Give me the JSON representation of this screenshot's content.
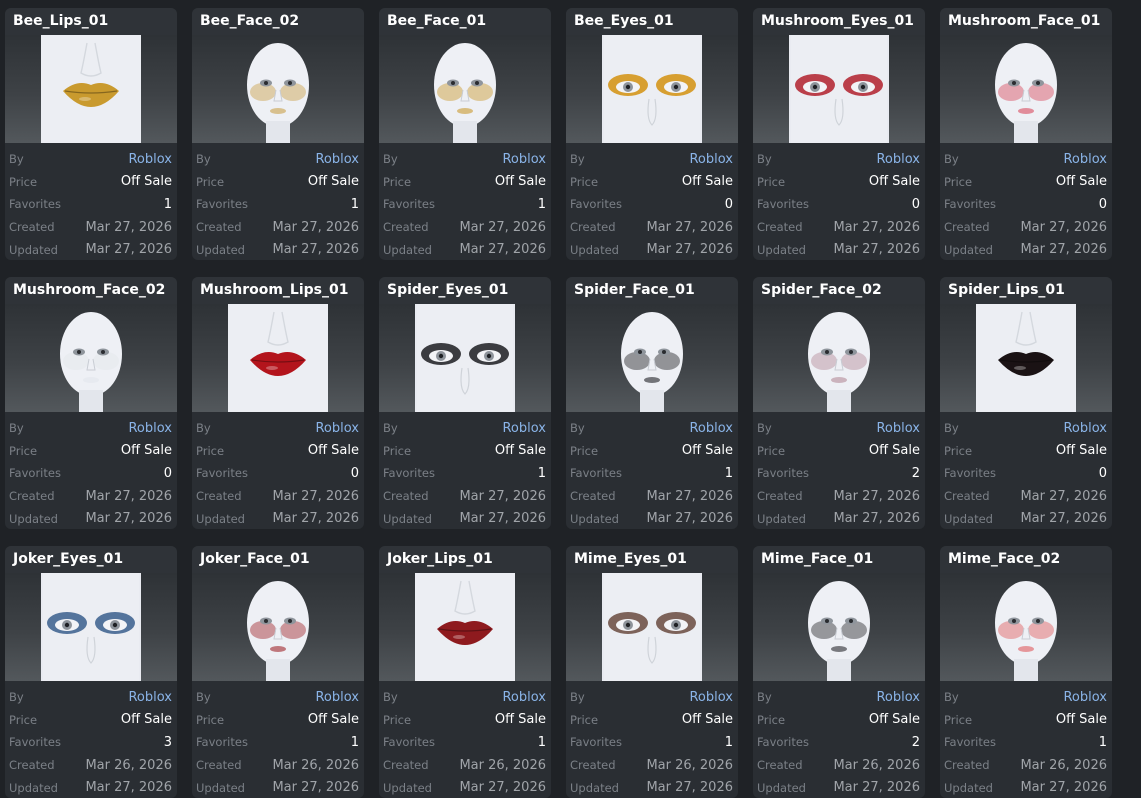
{
  "labels": {
    "by": "By",
    "price": "Price",
    "favorites": "Favorites",
    "created": "Created",
    "updated": "Updated"
  },
  "items": [
    {
      "name": "Bee_Lips_01",
      "creator": "Roblox",
      "price": "Off Sale",
      "favorites": "1",
      "created": "Mar 27, 2026",
      "updated": "Mar 27, 2026",
      "thumb": {
        "kind": "lips",
        "color": "#c99a2e"
      }
    },
    {
      "name": "Bee_Face_02",
      "creator": "Roblox",
      "price": "Off Sale",
      "favorites": "1",
      "created": "Mar 27, 2026",
      "updated": "Mar 27, 2026",
      "thumb": {
        "kind": "face",
        "color": "#c9a04a"
      }
    },
    {
      "name": "Bee_Face_01",
      "creator": "Roblox",
      "price": "Off Sale",
      "favorites": "1",
      "created": "Mar 27, 2026",
      "updated": "Mar 27, 2026",
      "thumb": {
        "kind": "face",
        "color": "#c99a2e"
      }
    },
    {
      "name": "Bee_Eyes_01",
      "creator": "Roblox",
      "price": "Off Sale",
      "favorites": "0",
      "created": "Mar 27, 2026",
      "updated": "Mar 27, 2026",
      "thumb": {
        "kind": "eyes",
        "color": "#d4900e"
      }
    },
    {
      "name": "Mushroom_Eyes_01",
      "creator": "Roblox",
      "price": "Off Sale",
      "favorites": "0",
      "created": "Mar 27, 2026",
      "updated": "Mar 27, 2026",
      "thumb": {
        "kind": "eyes",
        "color": "#b1202c"
      }
    },
    {
      "name": "Mushroom_Face_01",
      "creator": "Roblox",
      "price": "Off Sale",
      "favorites": "0",
      "created": "Mar 27, 2026",
      "updated": "Mar 27, 2026",
      "thumb": {
        "kind": "face",
        "color": "#d8495e"
      }
    },
    {
      "name": "Mushroom_Face_02",
      "creator": "Roblox",
      "price": "Off Sale",
      "favorites": "0",
      "created": "Mar 27, 2026",
      "updated": "Mar 27, 2026",
      "thumb": {
        "kind": "face",
        "color": "#e2e6ec"
      }
    },
    {
      "name": "Mushroom_Lips_01",
      "creator": "Roblox",
      "price": "Off Sale",
      "favorites": "0",
      "created": "Mar 27, 2026",
      "updated": "Mar 27, 2026",
      "thumb": {
        "kind": "lips",
        "color": "#b3141c"
      }
    },
    {
      "name": "Spider_Eyes_01",
      "creator": "Roblox",
      "price": "Off Sale",
      "favorites": "1",
      "created": "Mar 27, 2026",
      "updated": "Mar 27, 2026",
      "thumb": {
        "kind": "eyes",
        "color": "#1c1c20"
      }
    },
    {
      "name": "Spider_Face_01",
      "creator": "Roblox",
      "price": "Off Sale",
      "favorites": "1",
      "created": "Mar 27, 2026",
      "updated": "Mar 27, 2026",
      "thumb": {
        "kind": "face",
        "color": "#222226"
      }
    },
    {
      "name": "Spider_Face_02",
      "creator": "Roblox",
      "price": "Off Sale",
      "favorites": "2",
      "created": "Mar 27, 2026",
      "updated": "Mar 27, 2026",
      "thumb": {
        "kind": "face",
        "color": "#b48a98"
      }
    },
    {
      "name": "Spider_Lips_01",
      "creator": "Roblox",
      "price": "Off Sale",
      "favorites": "0",
      "created": "Mar 27, 2026",
      "updated": "Mar 27, 2026",
      "thumb": {
        "kind": "lips",
        "color": "#1a1214"
      }
    },
    {
      "name": "Joker_Eyes_01",
      "creator": "Roblox",
      "price": "Off Sale",
      "favorites": "3",
      "created": "Mar 26, 2026",
      "updated": "Mar 27, 2026",
      "thumb": {
        "kind": "eyes",
        "color": "#3a5e8c"
      }
    },
    {
      "name": "Joker_Face_01",
      "creator": "Roblox",
      "price": "Off Sale",
      "favorites": "1",
      "created": "Mar 26, 2026",
      "updated": "Mar 27, 2026",
      "thumb": {
        "kind": "face",
        "color": "#a0262c"
      }
    },
    {
      "name": "Joker_Lips_01",
      "creator": "Roblox",
      "price": "Off Sale",
      "favorites": "1",
      "created": "Mar 26, 2026",
      "updated": "Mar 27, 2026",
      "thumb": {
        "kind": "lips",
        "color": "#8e1a1e"
      }
    },
    {
      "name": "Mime_Eyes_01",
      "creator": "Roblox",
      "price": "Off Sale",
      "favorites": "1",
      "created": "Mar 26, 2026",
      "updated": "Mar 27, 2026",
      "thumb": {
        "kind": "eyes",
        "color": "#6a4a3e"
      }
    },
    {
      "name": "Mime_Face_01",
      "creator": "Roblox",
      "price": "Off Sale",
      "favorites": "2",
      "created": "Mar 26, 2026",
      "updated": "Mar 27, 2026",
      "thumb": {
        "kind": "face",
        "color": "#2a2a2e"
      }
    },
    {
      "name": "Mime_Face_02",
      "creator": "Roblox",
      "price": "Off Sale",
      "favorites": "1",
      "created": "Mar 26, 2026",
      "updated": "Mar 27, 2026",
      "thumb": {
        "kind": "face",
        "color": "#e05a5e"
      }
    }
  ]
}
